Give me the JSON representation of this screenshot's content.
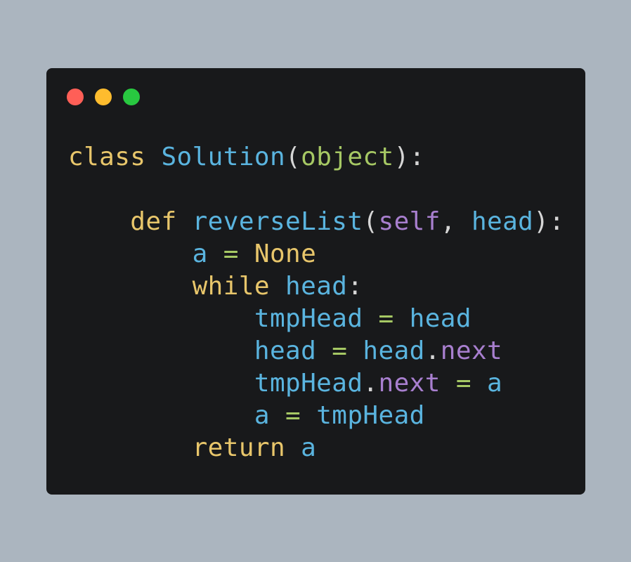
{
  "colors": {
    "background": "#abb5bf",
    "editor_bg": "#18191b",
    "dot_red": "#ff5f57",
    "dot_yellow": "#febc2e",
    "dot_green": "#28c840",
    "keyword": "#e8c66b",
    "name": "#5ab4df",
    "builtin": "#a6c864",
    "self": "#a87fcf",
    "attr": "#a87fcf",
    "operator": "#a6c864",
    "punct": "#d6d6d6"
  },
  "window_controls": [
    {
      "name": "close-dot",
      "color_key": "dot_red"
    },
    {
      "name": "minimize-dot",
      "color_key": "dot_yellow"
    },
    {
      "name": "maximize-dot",
      "color_key": "dot_green"
    }
  ],
  "code": {
    "language": "python",
    "lines": [
      [
        {
          "t": "class",
          "k": "keyword"
        },
        {
          "t": " ",
          "k": "punct"
        },
        {
          "t": "Solution",
          "k": "name"
        },
        {
          "t": "(",
          "k": "punct"
        },
        {
          "t": "object",
          "k": "builtin"
        },
        {
          "t": "):",
          "k": "punct"
        }
      ],
      [],
      [
        {
          "t": "    ",
          "k": "punct"
        },
        {
          "t": "def",
          "k": "keyword"
        },
        {
          "t": " ",
          "k": "punct"
        },
        {
          "t": "reverseList",
          "k": "name"
        },
        {
          "t": "(",
          "k": "punct"
        },
        {
          "t": "self",
          "k": "self"
        },
        {
          "t": ", ",
          "k": "punct"
        },
        {
          "t": "head",
          "k": "name"
        },
        {
          "t": "):",
          "k": "punct"
        }
      ],
      [
        {
          "t": "        ",
          "k": "punct"
        },
        {
          "t": "a",
          "k": "name"
        },
        {
          "t": " ",
          "k": "punct"
        },
        {
          "t": "=",
          "k": "operator"
        },
        {
          "t": " ",
          "k": "punct"
        },
        {
          "t": "None",
          "k": "keyword"
        }
      ],
      [
        {
          "t": "        ",
          "k": "punct"
        },
        {
          "t": "while",
          "k": "keyword"
        },
        {
          "t": " ",
          "k": "punct"
        },
        {
          "t": "head",
          "k": "name"
        },
        {
          "t": ":",
          "k": "punct"
        }
      ],
      [
        {
          "t": "            ",
          "k": "punct"
        },
        {
          "t": "tmpHead",
          "k": "name"
        },
        {
          "t": " ",
          "k": "punct"
        },
        {
          "t": "=",
          "k": "operator"
        },
        {
          "t": " ",
          "k": "punct"
        },
        {
          "t": "head",
          "k": "name"
        }
      ],
      [
        {
          "t": "            ",
          "k": "punct"
        },
        {
          "t": "head",
          "k": "name"
        },
        {
          "t": " ",
          "k": "punct"
        },
        {
          "t": "=",
          "k": "operator"
        },
        {
          "t": " ",
          "k": "punct"
        },
        {
          "t": "head",
          "k": "name"
        },
        {
          "t": ".",
          "k": "punct"
        },
        {
          "t": "next",
          "k": "attr"
        }
      ],
      [
        {
          "t": "            ",
          "k": "punct"
        },
        {
          "t": "tmpHead",
          "k": "name"
        },
        {
          "t": ".",
          "k": "punct"
        },
        {
          "t": "next",
          "k": "attr"
        },
        {
          "t": " ",
          "k": "punct"
        },
        {
          "t": "=",
          "k": "operator"
        },
        {
          "t": " ",
          "k": "punct"
        },
        {
          "t": "a",
          "k": "name"
        }
      ],
      [
        {
          "t": "            ",
          "k": "punct"
        },
        {
          "t": "a",
          "k": "name"
        },
        {
          "t": " ",
          "k": "punct"
        },
        {
          "t": "=",
          "k": "operator"
        },
        {
          "t": " ",
          "k": "punct"
        },
        {
          "t": "tmpHead",
          "k": "name"
        }
      ],
      [
        {
          "t": "        ",
          "k": "punct"
        },
        {
          "t": "return",
          "k": "keyword"
        },
        {
          "t": " ",
          "k": "punct"
        },
        {
          "t": "a",
          "k": "name"
        }
      ]
    ]
  }
}
